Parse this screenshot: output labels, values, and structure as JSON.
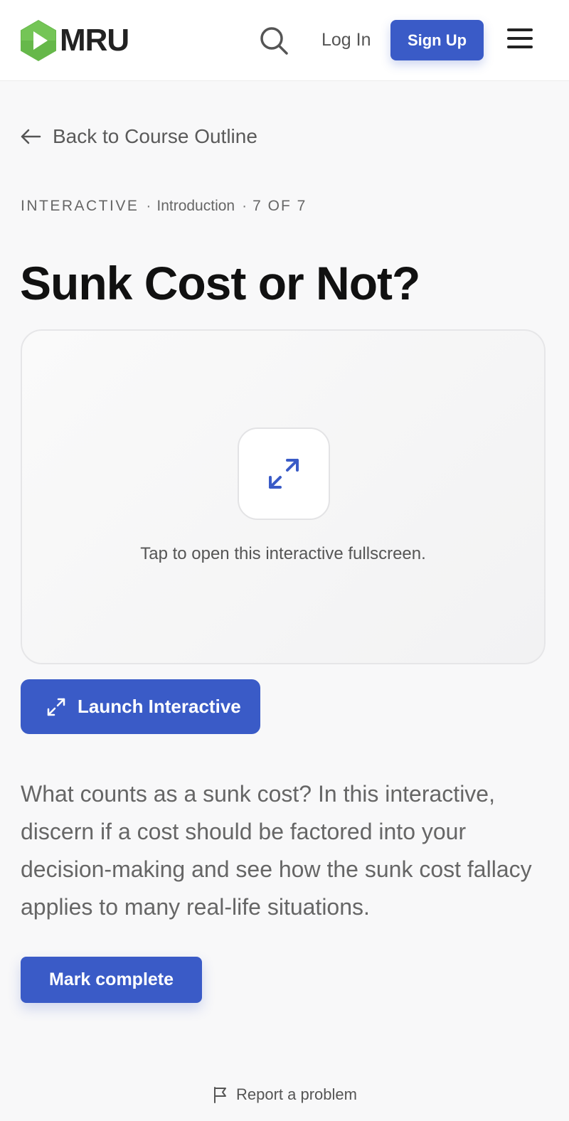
{
  "header": {
    "logo_text": "MRU",
    "logo_icon": "play-hexagon-icon",
    "search_icon": "search-icon",
    "login_label": "Log In",
    "signup_label": "Sign Up",
    "menu_icon": "hamburger-menu-icon"
  },
  "nav": {
    "back_label": "Back to Course Outline"
  },
  "meta": {
    "type": "INTERACTIVE",
    "separator": "·",
    "section": "Introduction",
    "count": "7 OF 7"
  },
  "page": {
    "title": "Sunk Cost or Not?"
  },
  "embed": {
    "caption": "Tap to open this interactive fullscreen.",
    "icon": "expand-arrows-icon"
  },
  "launch": {
    "label": "Launch Interactive"
  },
  "description": "What counts as a sunk cost? In this interactive, discern if a cost should be factored into your decision-making and see how the sunk cost fallacy applies to many real-life situations.",
  "actions": {
    "mark_complete_label": "Mark complete"
  },
  "footer": {
    "report_label": "Report a problem",
    "report_icon": "flag-icon"
  },
  "colors": {
    "accent": "#3a5bc7",
    "logo_green": "#5cb85c",
    "background": "#f8f8f9"
  }
}
